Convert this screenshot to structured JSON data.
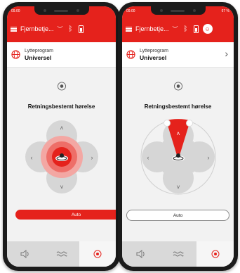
{
  "status": {
    "time": "09.00",
    "battery_text": "67 %"
  },
  "header": {
    "title": "Fjernbetje...",
    "chevron_icon": "chevron-down-icon",
    "bluetooth_icon": "bluetooth-icon",
    "battery_icon": "battery-icon",
    "avatar_icon": "avatar-icon"
  },
  "program": {
    "label": "Lytteprogram",
    "value": "Universel",
    "icon": "globe-icon"
  },
  "direction": {
    "title": "Retningsbestemt hørelse"
  },
  "auto": {
    "label": "Auto"
  },
  "tabs": [
    {
      "icon": "speaker-icon"
    },
    {
      "icon": "waves-icon"
    },
    {
      "icon": "target-icon"
    }
  ],
  "colors": {
    "accent": "#e5221c",
    "background": "#f2f2f2",
    "tabbar": "#d9d9d9"
  }
}
